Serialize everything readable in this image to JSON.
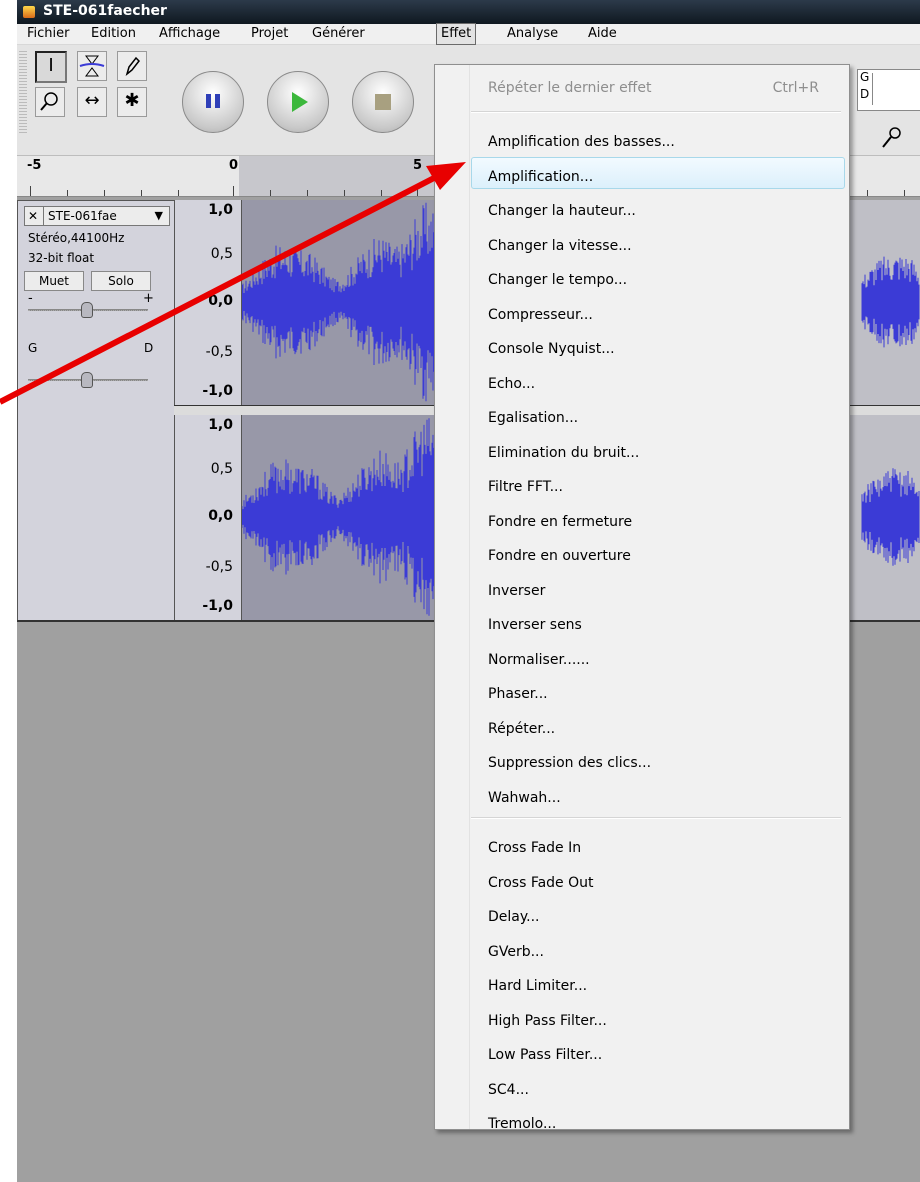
{
  "window": {
    "title": "STE-061faecher"
  },
  "menubar": {
    "items": [
      "Fichier",
      "Edition",
      "Affichage",
      "Projet",
      "Générer",
      "Effet",
      "Analyse",
      "Aide"
    ],
    "open_item": "Effet"
  },
  "toolbar": {
    "tools": [
      "selection-tool",
      "envelope-tool",
      "draw-tool",
      "zoom-tool",
      "time-shift-tool",
      "multi-tool"
    ],
    "transport": [
      "pause",
      "play",
      "stop"
    ],
    "meter_labels": {
      "left": "G",
      "right": "D"
    }
  },
  "ruler": {
    "ticks": [
      "-5",
      "0",
      "5"
    ]
  },
  "track": {
    "name": "STE-061fae",
    "info_line1": "Stéréo,44100Hz",
    "info_line2": "32-bit float",
    "mute_label": "Muet",
    "solo_label": "Solo",
    "gain_minus": "-",
    "gain_plus": "+",
    "pan_left": "G",
    "pan_right": "D",
    "scale_labels": [
      "1,0",
      "0,5",
      "0,0",
      "-0,5",
      "-1,0"
    ]
  },
  "effect_menu": {
    "repeat_last": {
      "label": "Répéter le dernier effet",
      "shortcut": "Ctrl+R"
    },
    "highlighted": "Amplification...",
    "group1": [
      "Amplification des basses...",
      "Amplification...",
      "Changer la hauteur...",
      "Changer la vitesse...",
      "Changer le tempo...",
      "Compresseur...",
      "Console Nyquist...",
      "Echo...",
      "Egalisation...",
      "Elimination du bruit...",
      "Filtre FFT...",
      "Fondre en fermeture",
      "Fondre en ouverture",
      "Inverser",
      "Inverser sens",
      "Normaliser......",
      "Phaser...",
      "Répéter...",
      "Suppression des clics...",
      "Wahwah..."
    ],
    "group2": [
      "Cross Fade In",
      "Cross Fade Out",
      "Delay...",
      "GVerb...",
      "Hard Limiter...",
      "High Pass Filter...",
      "Low Pass Filter...",
      "SC4...",
      "Tremolo..."
    ]
  },
  "colors": {
    "annotation_arrow": "#e80000",
    "waveform": "#3b3bd6",
    "highlight_border": "#a8d8ea"
  }
}
